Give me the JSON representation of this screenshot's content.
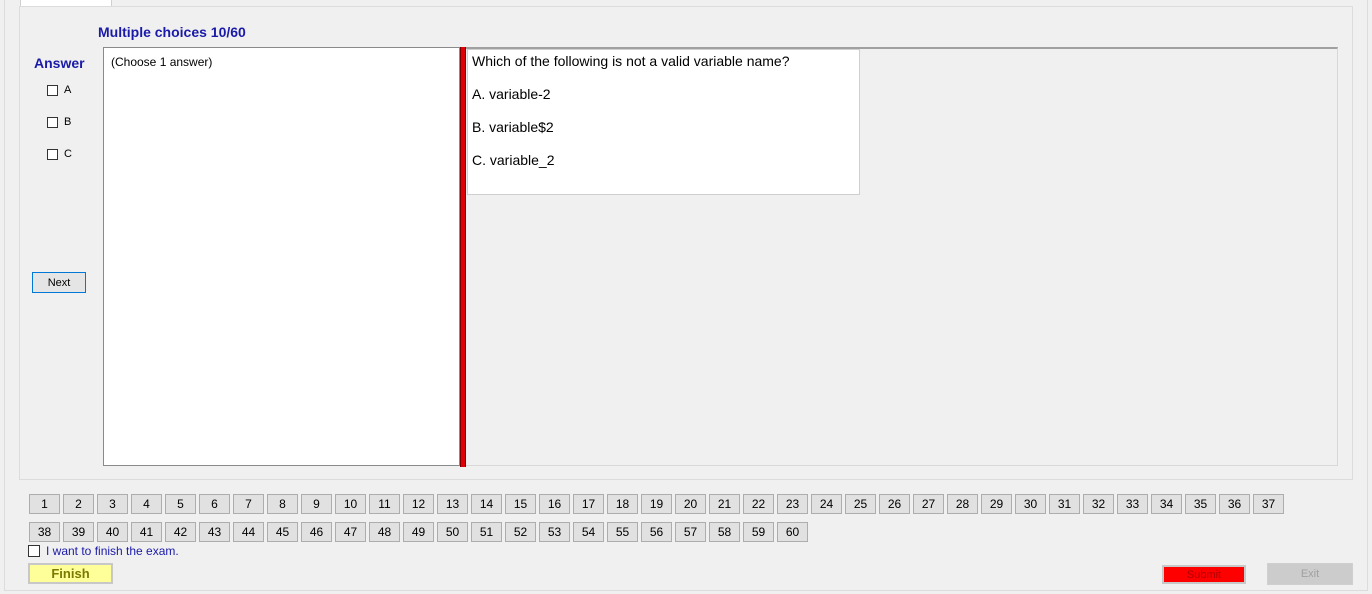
{
  "header": {
    "title": "Multiple choices 10/60"
  },
  "answer": {
    "label": "Answer",
    "options": [
      "A",
      "B",
      "C"
    ],
    "next_label": "Next",
    "instruction": "(Choose 1 answer)"
  },
  "question": {
    "text": "Which of the following is not a valid variable name?",
    "options": [
      "A.  variable-2",
      "B.  variable$2",
      "C.  variable_2"
    ]
  },
  "navigation": {
    "row1": [
      "1",
      "2",
      "3",
      "4",
      "5",
      "6",
      "7",
      "8",
      "9",
      "10",
      "11",
      "12",
      "13",
      "14",
      "15",
      "16",
      "17",
      "18",
      "19",
      "20",
      "21",
      "22",
      "23",
      "24",
      "25",
      "26",
      "27",
      "28",
      "29",
      "30",
      "31",
      "32",
      "33",
      "34",
      "35",
      "36",
      "37"
    ],
    "row2": [
      "38",
      "39",
      "40",
      "41",
      "42",
      "43",
      "44",
      "45",
      "46",
      "47",
      "48",
      "49",
      "50",
      "51",
      "52",
      "53",
      "54",
      "55",
      "56",
      "57",
      "58",
      "59",
      "60"
    ]
  },
  "footer": {
    "finish_check_label": "I want to finish the exam.",
    "finish_label": "Finish",
    "submit_label": "Submit",
    "exit_label": "Exit"
  },
  "colors": {
    "accent": "#1a1aa8",
    "divider_red": "#e0000a",
    "finish_bg": "#ffff99",
    "submit_bg": "#ff0000"
  }
}
